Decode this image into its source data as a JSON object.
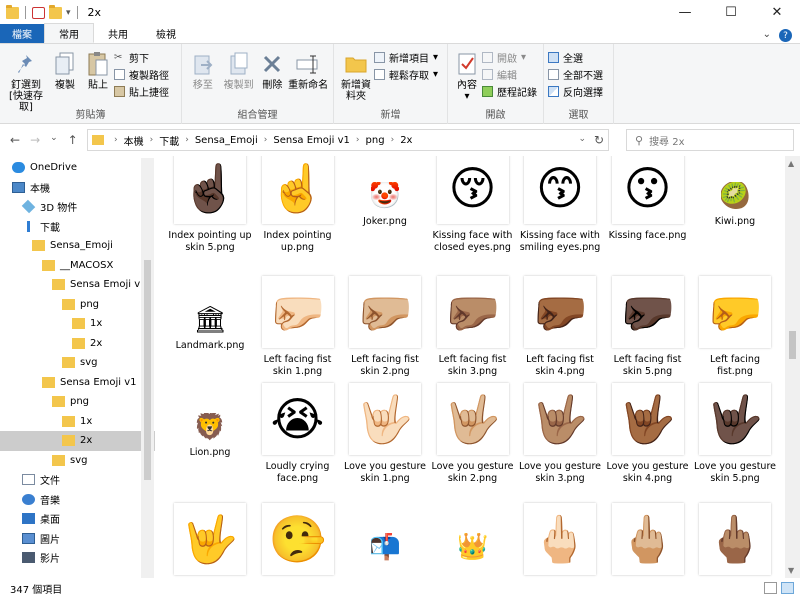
{
  "window": {
    "title": "2x",
    "min": "—",
    "max": "☐",
    "close": "✕"
  },
  "quick_access": {
    "dropdown": "▾"
  },
  "tabs": [
    "檔案",
    "常用",
    "共用",
    "檢視"
  ],
  "help": {
    "expand": "⌄",
    "help": "?"
  },
  "ribbon": {
    "clipboard": {
      "pin": "釘選到 [快速存取]",
      "copy": "複製",
      "paste": "貼上",
      "cut": "剪下",
      "copy_path": "複製路徑",
      "paste_shortcut": "貼上捷徑",
      "label": "剪貼簿"
    },
    "organize": {
      "move_to": "移至",
      "copy_to": "複製到",
      "delete": "刪除",
      "rename": "重新命名",
      "label": "組合管理"
    },
    "new": {
      "new_folder": "新增資料夾",
      "new_item": "新增項目",
      "easy_access": "輕鬆存取",
      "label": "新增"
    },
    "open": {
      "properties": "內容",
      "open": "開啟",
      "edit": "編輯",
      "history": "歷程記錄",
      "label": "開啟"
    },
    "select": {
      "select_all": "全選",
      "select_none": "全部不選",
      "invert": "反向選擇",
      "label": "選取"
    }
  },
  "address": {
    "back": "←",
    "forward": "→",
    "recent": "⌄",
    "up": "↑",
    "crumbs": [
      "本機",
      "下載",
      "Sensa_Emoji",
      "Sensa Emoji v1",
      "png",
      "2x"
    ],
    "search_placeholder": "搜尋 2x"
  },
  "sidebar": {
    "items": [
      {
        "label": "OneDrive",
        "icon": "cloud-icon",
        "indent": 1
      },
      {
        "label": "本機",
        "icon": "computer-icon",
        "indent": 1
      },
      {
        "label": "3D 物件",
        "icon": "cube-icon",
        "indent": 2
      },
      {
        "label": "下載",
        "icon": "download-icon",
        "indent": 2
      },
      {
        "label": "Sensa_Emoji",
        "icon": "folder-icon",
        "indent": 3
      },
      {
        "label": "__MACOSX",
        "icon": "folder-icon",
        "indent": 4
      },
      {
        "label": "Sensa Emoji v1",
        "icon": "folder-icon",
        "indent": 5
      },
      {
        "label": "png",
        "icon": "folder-icon",
        "indent": 6
      },
      {
        "label": "1x",
        "icon": "folder-icon",
        "indent": 7
      },
      {
        "label": "2x",
        "icon": "folder-icon",
        "indent": 7
      },
      {
        "label": "svg",
        "icon": "folder-icon",
        "indent": 6
      },
      {
        "label": "Sensa Emoji v1",
        "icon": "folder-icon",
        "indent": 4
      },
      {
        "label": "png",
        "icon": "folder-icon",
        "indent": 5
      },
      {
        "label": "1x",
        "icon": "folder-icon",
        "indent": 6
      },
      {
        "label": "2x",
        "icon": "folder-icon",
        "indent": 6,
        "selected": true
      },
      {
        "label": "svg",
        "icon": "folder-icon",
        "indent": 5
      },
      {
        "label": "文件",
        "icon": "document-icon",
        "indent": 2
      },
      {
        "label": "音樂",
        "icon": "music-icon",
        "indent": 2
      },
      {
        "label": "桌面",
        "icon": "desktop-icon",
        "indent": 2
      },
      {
        "label": "圖片",
        "icon": "picture-icon",
        "indent": 2
      },
      {
        "label": "影片",
        "icon": "video-icon",
        "indent": 2
      }
    ]
  },
  "files": [
    {
      "name": "Index pointing up skin 5.png",
      "icon": "☝🏿"
    },
    {
      "name": "Index pointing up.png",
      "icon": "☝️"
    },
    {
      "name": "Joker.png",
      "icon": "🤡",
      "small": true
    },
    {
      "name": "Kissing face with closed eyes.png",
      "icon": "😚"
    },
    {
      "name": "Kissing face with smiling eyes.png",
      "icon": "😙"
    },
    {
      "name": "Kissing face.png",
      "icon": "😗"
    },
    {
      "name": "Kiwi.png",
      "icon": "🥝",
      "small": true
    },
    {
      "name": "Landmark.png",
      "icon": "🏛",
      "small": true
    },
    {
      "name": "Left facing fist skin 1.png",
      "icon": "🤛🏻"
    },
    {
      "name": "Left facing fist skin 2.png",
      "icon": "🤛🏼"
    },
    {
      "name": "Left facing fist skin 3.png",
      "icon": "🤛🏽"
    },
    {
      "name": "Left facing fist skin 4.png",
      "icon": "🤛🏾"
    },
    {
      "name": "Left facing fist skin 5.png",
      "icon": "🤛🏿"
    },
    {
      "name": "Left facing fist.png",
      "icon": "🤛"
    },
    {
      "name": "Lion.png",
      "icon": "🦁",
      "small": true
    },
    {
      "name": "Loudly crying face.png",
      "icon": "😭"
    },
    {
      "name": "Love you gesture skin 1.png",
      "icon": "🤟🏻"
    },
    {
      "name": "Love you gesture skin 2.png",
      "icon": "🤟🏼"
    },
    {
      "name": "Love you gesture skin 3.png",
      "icon": "🤟🏽"
    },
    {
      "name": "Love you gesture skin 4.png",
      "icon": "🤟🏾"
    },
    {
      "name": "Love you gesture skin 5.png",
      "icon": "🤟🏿"
    },
    {
      "name": "",
      "icon": "🤟"
    },
    {
      "name": "",
      "icon": "🤥"
    },
    {
      "name": "",
      "icon": "📬",
      "small": true
    },
    {
      "name": "",
      "icon": "👑",
      "small": true
    },
    {
      "name": "",
      "icon": "🖕🏻"
    },
    {
      "name": "",
      "icon": "🖕🏼"
    },
    {
      "name": "",
      "icon": "🖕🏽"
    }
  ],
  "status": {
    "count": "347 個項目"
  }
}
